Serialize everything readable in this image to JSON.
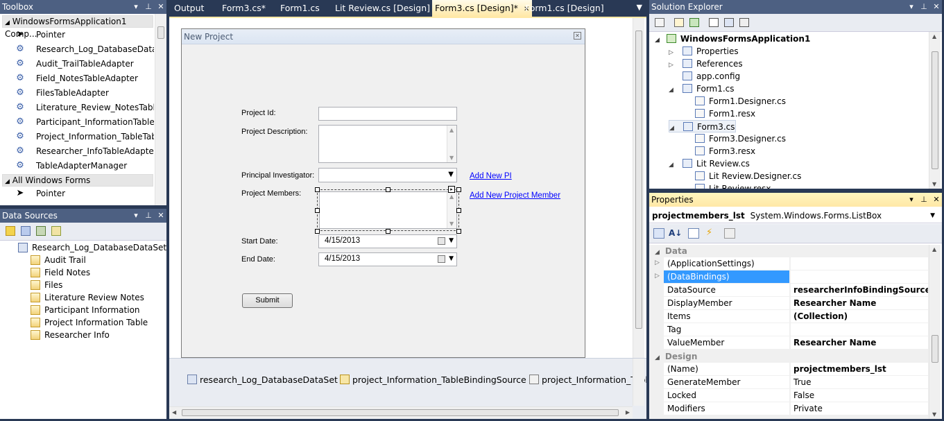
{
  "toolbox": {
    "title": "Toolbox",
    "group1": "WindowsFormsApplication1 Comp...",
    "items": [
      {
        "label": "Pointer",
        "icon": "pointer-icon"
      },
      {
        "label": "Research_Log_DatabaseDataSet",
        "icon": "gear-icon"
      },
      {
        "label": "Audit_TrailTableAdapter",
        "icon": "gear-icon"
      },
      {
        "label": "Field_NotesTableAdapter",
        "icon": "gear-icon"
      },
      {
        "label": "FilesTableAdapter",
        "icon": "gear-icon"
      },
      {
        "label": "Literature_Review_NotesTable...",
        "icon": "gear-icon"
      },
      {
        "label": "Participant_InformationTable...",
        "icon": "gear-icon"
      },
      {
        "label": "Project_Information_TableTab...",
        "icon": "gear-icon"
      },
      {
        "label": "Researcher_InfoTableAdapter",
        "icon": "gear-icon"
      },
      {
        "label": "TableAdapterManager",
        "icon": "gear-icon"
      }
    ],
    "group2": "All Windows Forms",
    "group2_items": [
      {
        "label": "Pointer",
        "icon": "pointer-icon"
      }
    ]
  },
  "data_sources": {
    "title": "Data Sources",
    "root": "Research_Log_DatabaseDataSet",
    "tables": [
      "Audit Trail",
      "Field Notes",
      "Files",
      "Literature Review Notes",
      "Participant Information",
      "Project Information Table",
      "Researcher Info"
    ]
  },
  "tabs": [
    {
      "label": "Output",
      "active": false
    },
    {
      "label": "Form3.cs*",
      "active": false
    },
    {
      "label": "Form1.cs",
      "active": false
    },
    {
      "label": "Lit Review.cs [Design]",
      "active": false
    },
    {
      "label": "Form3.cs [Design]*",
      "active": true
    },
    {
      "label": "Form1.cs [Design]",
      "active": false
    }
  ],
  "form": {
    "title": "New Project",
    "project_id_label": "Project Id:",
    "project_desc_label": "Project Description:",
    "pi_label": "Principal Investigator:",
    "members_label": "Project Members:",
    "start_label": "Start Date:",
    "start_value": "4/15/2013",
    "end_label": "End Date:",
    "end_value": "4/15/2013",
    "submit_label": "Submit",
    "add_pi_link": "Add New PI",
    "add_member_link": "Add New Project Member"
  },
  "tray": {
    "items": [
      "research_Log_DatabaseDataSet",
      "project_Information_TableBindingSource",
      "project_Information_Tabl"
    ]
  },
  "solution_explorer": {
    "title": "Solution Explorer",
    "project": "WindowsFormsApplication1",
    "nodes": [
      {
        "label": "Properties",
        "indent": 1,
        "expander": "▷"
      },
      {
        "label": "References",
        "indent": 1,
        "expander": "▷"
      },
      {
        "label": "app.config",
        "indent": 1,
        "expander": ""
      },
      {
        "label": "Form1.cs",
        "indent": 1,
        "expander": "◢"
      },
      {
        "label": "Form1.Designer.cs",
        "indent": 2,
        "expander": ""
      },
      {
        "label": "Form1.resx",
        "indent": 2,
        "expander": ""
      },
      {
        "label": "Form3.cs",
        "indent": 1,
        "expander": "◢"
      },
      {
        "label": "Form3.Designer.cs",
        "indent": 2,
        "expander": ""
      },
      {
        "label": "Form3.resx",
        "indent": 2,
        "expander": ""
      },
      {
        "label": "Lit Review.cs",
        "indent": 1,
        "expander": "◢"
      },
      {
        "label": "Lit Review.Designer.cs",
        "indent": 2,
        "expander": ""
      },
      {
        "label": "Lit Review.resx",
        "indent": 2,
        "expander": ""
      }
    ]
  },
  "properties": {
    "title": "Properties",
    "object_name": "projectmembers_lst",
    "object_type": "System.Windows.Forms.ListBox",
    "cat_data": "Data",
    "cat_design": "Design",
    "rows_data": [
      {
        "name": "(ApplicationSettings)",
        "value": "",
        "bold": false,
        "expander": true
      },
      {
        "name": "(DataBindings)",
        "value": "",
        "bold": false,
        "expander": true,
        "selected": true
      },
      {
        "name": "DataSource",
        "value": "researcherInfoBindingSource",
        "bold": true
      },
      {
        "name": "DisplayMember",
        "value": "Researcher Name",
        "bold": true
      },
      {
        "name": "Items",
        "value": "(Collection)",
        "bold": true
      },
      {
        "name": "Tag",
        "value": "",
        "bold": false
      },
      {
        "name": "ValueMember",
        "value": "Researcher Name",
        "bold": true
      }
    ],
    "rows_design": [
      {
        "name": "(Name)",
        "value": "projectmembers_lst",
        "bold": true
      },
      {
        "name": "GenerateMember",
        "value": "True",
        "bold": false
      },
      {
        "name": "Locked",
        "value": "False",
        "bold": false
      },
      {
        "name": "Modifiers",
        "value": "Private",
        "bold": false
      }
    ]
  }
}
